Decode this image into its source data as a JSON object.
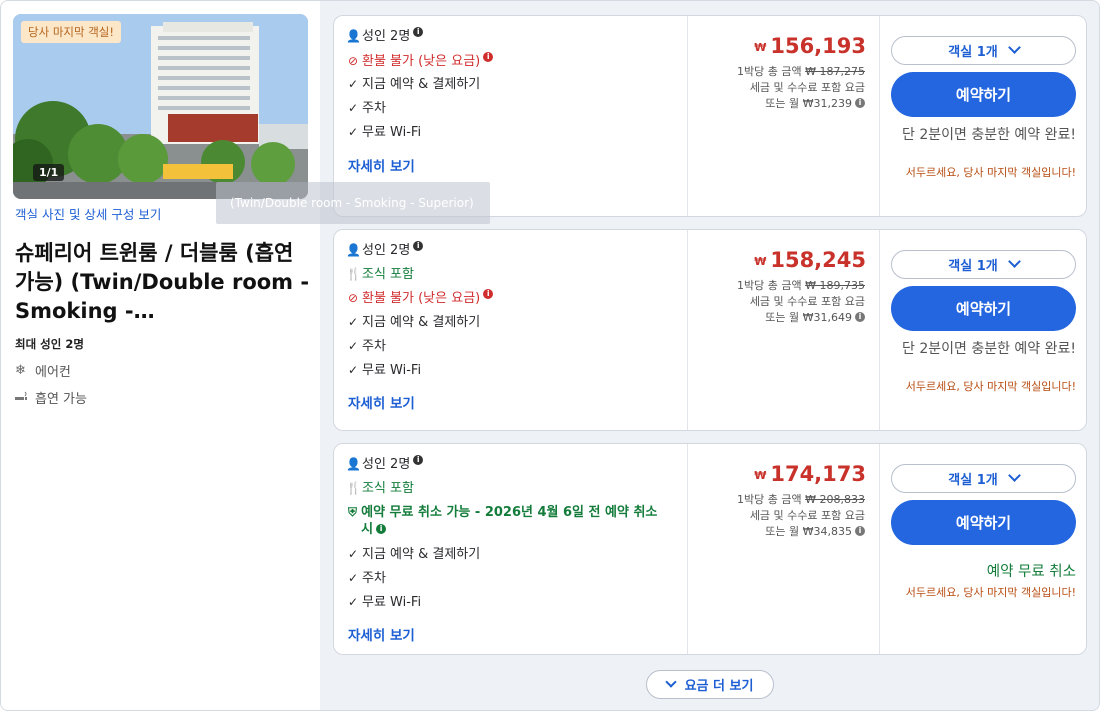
{
  "room": {
    "badge": "당사 마지막 객실!",
    "photo_count": "1/1",
    "tooltip": "(Twin/Double room - Smoking - Superior)",
    "photo_link": "객실 사진 및 상세 구성 보기",
    "title": "슈페리어 트윈룸 / 더블룸 (흡연 가능) (Twin/Double room - Smoking -…",
    "max_guests": "최대 성인 2명",
    "amenities": [
      {
        "icon": "snowflake-icon",
        "label": "에어컨"
      },
      {
        "icon": "smoking-icon",
        "label": "흡연 가능"
      }
    ]
  },
  "rates": [
    {
      "occupancy": "성인 2명",
      "breakfast": null,
      "policy": "환불 불가 (낮은 요금)",
      "policy_type": "nonrefundable",
      "features": [
        "지금 예약 & 결제하기",
        "주차",
        "무료 Wi-Fi"
      ],
      "details_link": "자세히 보기",
      "currency": "₩",
      "price": "156,193",
      "total_label": "1박당 총 금액",
      "total_strike": "₩ 187,275",
      "tax_note": "세금 및 수수료 포함 요금",
      "monthly": "또는 월 ₩31,239",
      "room_select": "객실 1개",
      "book_label": "예약하기",
      "urgency": "단 2분이면 충분한 예약 완료!",
      "urgency_sub": "서두르세요, 당사 마지막 객실입니다!"
    },
    {
      "occupancy": "성인 2명",
      "breakfast": "조식 포함",
      "policy": "환불 불가 (낮은 요금)",
      "policy_type": "nonrefundable",
      "features": [
        "지금 예약 & 결제하기",
        "주차",
        "무료 Wi-Fi"
      ],
      "details_link": "자세히 보기",
      "currency": "₩",
      "price": "158,245",
      "total_label": "1박당 총 금액",
      "total_strike": "₩ 189,735",
      "tax_note": "세금 및 수수료 포함 요금",
      "monthly": "또는 월 ₩31,649",
      "room_select": "객실 1개",
      "book_label": "예약하기",
      "urgency": "단 2분이면 충분한 예약 완료!",
      "urgency_sub": "서두르세요, 당사 마지막 객실입니다!"
    },
    {
      "occupancy": "성인 2명",
      "breakfast": "조식 포함",
      "policy": "예약 무료 취소 가능 - 2026년 4월 6일 전 예약 취소 시",
      "policy_type": "free_cancel",
      "features": [
        "지금 예약 & 결제하기",
        "주차",
        "무료 Wi-Fi"
      ],
      "details_link": "자세히 보기",
      "currency": "₩",
      "price": "174,173",
      "total_label": "1박당 총 금액",
      "total_strike": "₩ 208,833",
      "tax_note": "세금 및 수수료 포함 요금",
      "monthly": "또는 월 ₩34,835",
      "room_select": "객실 1개",
      "book_label": "예약하기",
      "free_cancel": "예약 무료 취소",
      "urgency_sub": "서두르세요, 당사 마지막 객실입니다!"
    }
  ],
  "more_rates": "요금 더 보기"
}
